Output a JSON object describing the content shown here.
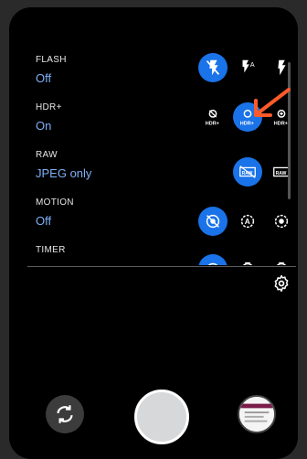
{
  "settings": [
    {
      "title": "FLASH",
      "value": "Off",
      "options": [
        "flash-off",
        "flash-auto",
        "flash-on"
      ],
      "selected": 0,
      "option_labels": [
        "",
        "A",
        ""
      ]
    },
    {
      "title": "HDR+",
      "value": "On",
      "options": [
        "hdr-off",
        "hdr-on",
        "hdr-enhanced"
      ],
      "selected": 1,
      "option_labels": [
        "HDR+",
        "HDR+",
        "HDR+"
      ]
    },
    {
      "title": "RAW",
      "value": "JPEG only",
      "options": [
        "raw-off",
        "raw-on"
      ],
      "selected": 0,
      "option_labels": [
        "RAW",
        "RAW"
      ]
    },
    {
      "title": "MOTION",
      "value": "Off",
      "options": [
        "motion-off",
        "motion-auto",
        "motion-on"
      ],
      "selected": 0,
      "option_labels": [
        "",
        "A",
        ""
      ]
    },
    {
      "title": "TIMER",
      "value": "",
      "options": [
        "timer-off",
        "timer-3s",
        "timer-10s"
      ],
      "selected": 0,
      "option_labels": [
        "",
        "",
        ""
      ]
    }
  ],
  "icons": {
    "settings": "gear-icon",
    "switch_camera": "camera-switch-icon",
    "shutter": "shutter-button",
    "gallery": "gallery-thumbnail"
  },
  "colors": {
    "accent": "#1a73e8",
    "value_text": "#7fb0f5",
    "annotation_arrow": "#ff5a2a"
  }
}
